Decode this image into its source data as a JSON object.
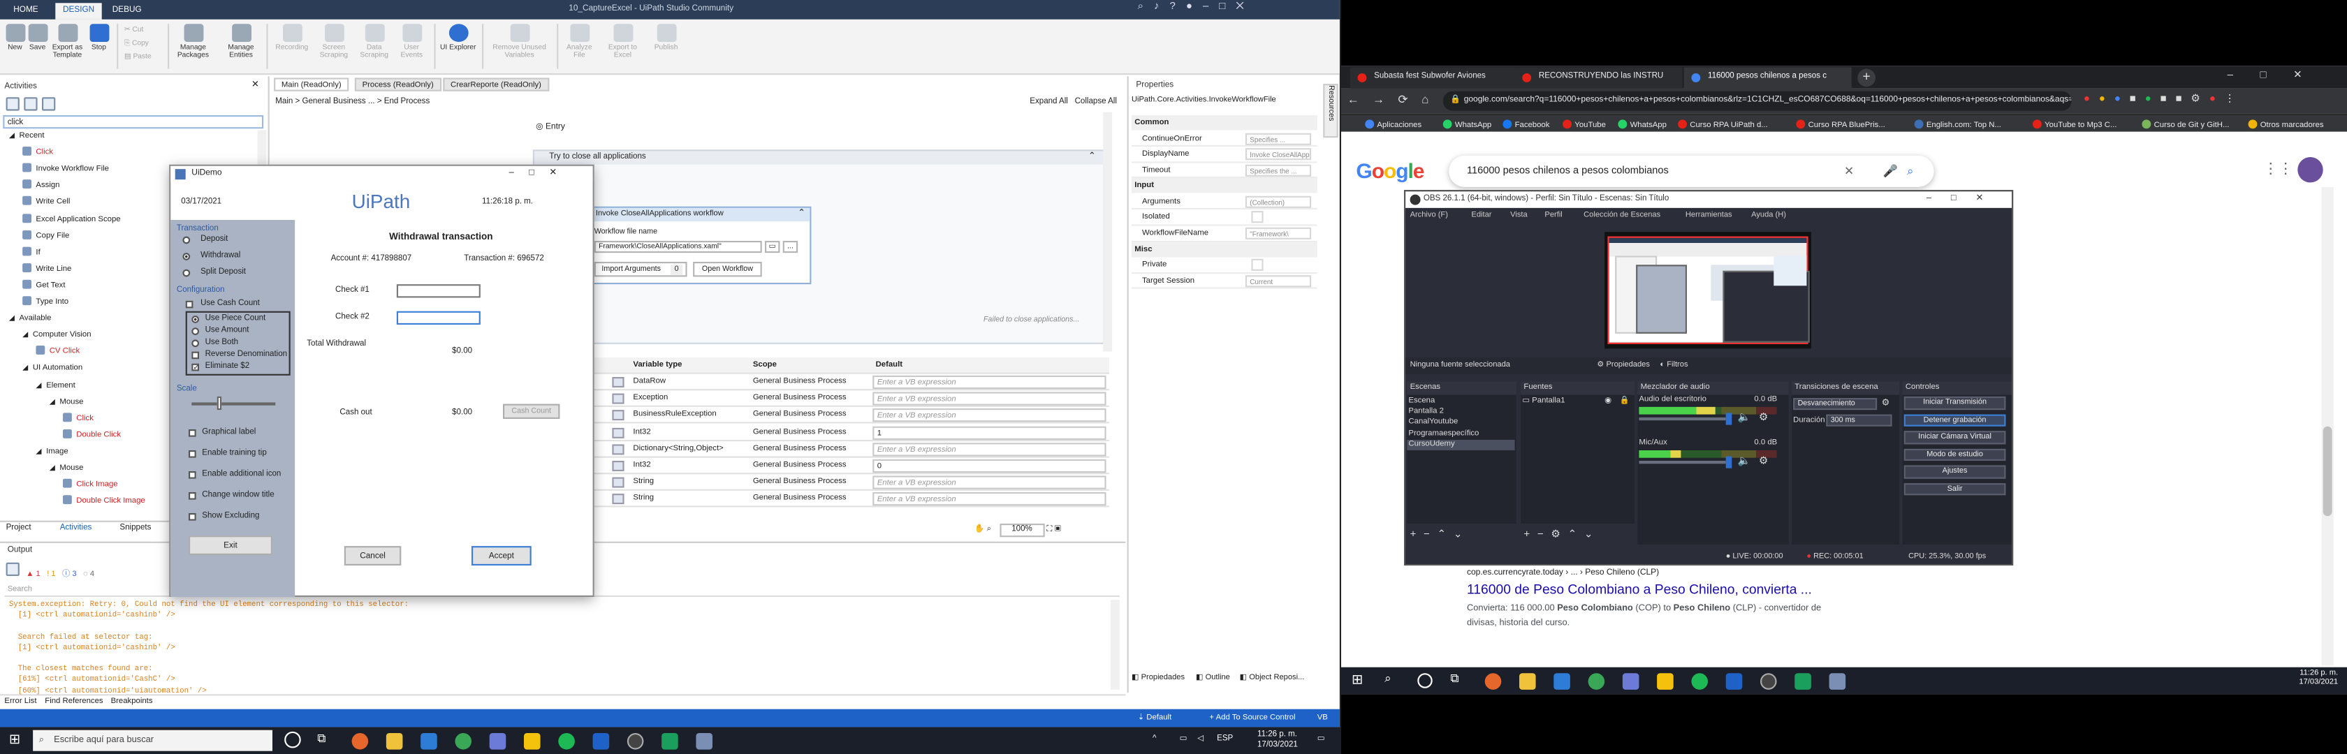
{
  "uipath": {
    "window_title": "10_CaptureExcel - UiPath Studio Community",
    "ribbon_tabs": [
      "HOME",
      "DESIGN",
      "DEBUG"
    ],
    "ribbon_buttons": [
      {
        "label": "New",
        "disabled": false
      },
      {
        "label": "Save",
        "disabled": false
      },
      {
        "label": "Export as Template",
        "disabled": false
      },
      {
        "label": "Stop",
        "disabled": false
      },
      {
        "label": "Cut",
        "disabled": true
      },
      {
        "label": "Copy",
        "disabled": true
      },
      {
        "label": "Paste",
        "disabled": true
      },
      {
        "label": "Manage Packages",
        "disabled": false
      },
      {
        "label": "Manage Entities",
        "disabled": false
      },
      {
        "label": "Recording",
        "disabled": true
      },
      {
        "label": "Screen Scraping",
        "disabled": true
      },
      {
        "label": "Data Scraping",
        "disabled": true
      },
      {
        "label": "User Events",
        "disabled": true
      },
      {
        "label": "UI Explorer",
        "disabled": false
      },
      {
        "label": "Remove Unused Variables",
        "disabled": true
      },
      {
        "label": "Analyze File",
        "disabled": true
      },
      {
        "label": "Export to Excel",
        "disabled": true
      },
      {
        "label": "Publish",
        "disabled": true
      }
    ],
    "activities_panel": {
      "title": "Activities",
      "search_value": "click",
      "rows": [
        {
          "text": "Recent",
          "level": 0
        },
        {
          "text": "Click",
          "level": 1,
          "red": true
        },
        {
          "text": "Invoke Workflow File",
          "level": 1
        },
        {
          "text": "Assign",
          "level": 1
        },
        {
          "text": "Write Cell",
          "level": 1
        },
        {
          "text": "Excel Application Scope",
          "level": 1
        },
        {
          "text": "Copy File",
          "level": 1
        },
        {
          "text": "If",
          "level": 1
        },
        {
          "text": "Write Line",
          "level": 1
        },
        {
          "text": "Get Text",
          "level": 1
        },
        {
          "text": "Type Into",
          "level": 1
        },
        {
          "text": "Available",
          "level": 0
        },
        {
          "text": "Computer Vision",
          "level": 1
        },
        {
          "text": "CV Click",
          "level": 2,
          "red": true
        },
        {
          "text": "UI Automation",
          "level": 1
        },
        {
          "text": "Element",
          "level": 2
        },
        {
          "text": "Mouse",
          "level": 3
        },
        {
          "text": "Click",
          "level": 4,
          "red": true
        },
        {
          "text": "Double Click",
          "level": 4,
          "red": true
        },
        {
          "text": "Image",
          "level": 2
        },
        {
          "text": "Mouse",
          "level": 3
        },
        {
          "text": "Click Image",
          "level": 4,
          "red": true
        },
        {
          "text": "Double Click Image",
          "level": 4,
          "red": true
        }
      ],
      "bottom_tabs": [
        "Project",
        "Activities",
        "Snippets"
      ]
    },
    "doc_tabs": [
      "Main (ReadOnly)",
      "Process (ReadOnly)",
      "CrearReporte (ReadOnly)"
    ],
    "breadcrumb": [
      "Main",
      "General Business ...",
      "End Process"
    ],
    "expand_all": "Expand All",
    "collapse_all": "Collapse All",
    "designer": {
      "entry": "Entry",
      "try_close": "Try to close all applications",
      "invoke_title": "Invoke CloseAllApplications workflow",
      "workflow_file_label": "Workflow file name",
      "workflow_file_value": "Framework\\CloseAllApplications.xaml\"",
      "import_args": "Import Arguments",
      "import_count": "0",
      "open_workflow": "Open Workflow",
      "failed_text": "Failed to close applications..."
    },
    "variables_grid": {
      "headers": [
        "Variable type",
        "Scope",
        "Default"
      ],
      "rows": [
        {
          "type": "DataRow",
          "scope": "General Business Process",
          "default": "Enter a VB expression"
        },
        {
          "type": "Exception",
          "scope": "General Business Process",
          "default": "Enter a VB expression"
        },
        {
          "type": "BusinessRuleException",
          "scope": "General Business Process",
          "default": "Enter a VB expression"
        },
        {
          "type": "Int32",
          "scope": "General Business Process",
          "default": "1"
        },
        {
          "type": "Dictionary<String,Object>",
          "scope": "General Business Process",
          "default": "Enter a VB expression"
        },
        {
          "type": "Int32",
          "scope": "General Business Process",
          "default": "0"
        },
        {
          "type": "String",
          "scope": "General Business Process",
          "default": "Enter a VB expression"
        },
        {
          "type": "String",
          "scope": "General Business Process",
          "default": "Enter a VB expression"
        }
      ],
      "zoom": "100%"
    },
    "properties": {
      "title": "Properties",
      "type_name": "UiPath.Core.Activities.InvokeWorkflowFile",
      "categories": [
        {
          "name": "Common",
          "rows": [
            {
              "label": "ContinueOnError",
              "value": "Specifies ..."
            },
            {
              "label": "DisplayName",
              "value": "Invoke CloseAllApp"
            },
            {
              "label": "Timeout",
              "value": "Specifies the ..."
            }
          ]
        },
        {
          "name": "Input",
          "rows": [
            {
              "label": "Arguments",
              "value": "(Collection)"
            },
            {
              "label": "Isolated",
              "value": ""
            },
            {
              "label": "WorkflowFileName",
              "value": "\"Framework\\"
            }
          ]
        },
        {
          "name": "Misc",
          "rows": [
            {
              "label": "Private",
              "value": ""
            },
            {
              "label": "Target Session",
              "value": "Current"
            }
          ]
        }
      ],
      "bottom_tabs": [
        "Propiedades",
        "Outline",
        "Object Reposi..."
      ],
      "side_tab": "Resources"
    },
    "output": {
      "title": "Output",
      "filter_counts": [
        "1",
        "1",
        "3",
        "4"
      ],
      "search_placeholder": "Search",
      "lines": [
        {
          "text": "System.exception: Retry: 0, Could not find the UI element corresponding to this selector:",
          "color": "#d9821f"
        },
        {
          "text": "[1] <ctrl automationid='cashinb' />",
          "color": "#d9821f"
        },
        {
          "text": "",
          "color": "#d9821f"
        },
        {
          "text": "Search failed at selector tag:",
          "color": "#d9821f"
        },
        {
          "text": "[1] <ctrl automationid='cashinb' />",
          "color": "#d9821f"
        },
        {
          "text": "",
          "color": "#d9821f"
        },
        {
          "text": "The closest matches found are:",
          "color": "#d9821f"
        },
        {
          "text": "[61%] <ctrl automationid='CashC' />",
          "color": "#d9821f"
        },
        {
          "text": "[60%] <ctrl automationid='uiautomation' />",
          "color": "#d9821f"
        }
      ],
      "bottom_tabs": [
        "Error List",
        "Find References",
        "Breakpoints"
      ]
    },
    "status_bar": {
      "config": "Default",
      "source_control": "Add To Source Control",
      "lang": "VB"
    }
  },
  "uidemo": {
    "title": "UiDemo",
    "date": "03/17/2021",
    "brand": "UiPath",
    "time": "11:26:18 p. m.",
    "transaction_label": "Transaction",
    "transaction_options": [
      "Deposit",
      "Withdrawal",
      "Split Deposit"
    ],
    "selected_transaction": "Withdrawal",
    "configuration_label": "Configuration",
    "use_cash_count": "Use Cash Count",
    "config_options": [
      "Use Piece Count",
      "Use Amount",
      "Use Both",
      "Reverse Denomination",
      "Eliminate $2"
    ],
    "scale_label": "Scale",
    "scale_value": 0.33,
    "checkboxes": [
      "Graphical label",
      "Enable training tip",
      "Enable additional icon",
      "Change window title",
      "Show Excluding"
    ],
    "exit": "Exit",
    "heading": "Withdrawal transaction",
    "account": "Account #: 417898807",
    "transaction_no": "Transaction #: 696572",
    "check1": "Check #1",
    "check2": "Check #2",
    "total_withdrawal": "Total Withdrawal",
    "total_value": "$0.00",
    "cash_out": "Cash out",
    "cash_out_value": "$0.00",
    "cash_count_btn": "Cash Count",
    "cancel": "Cancel",
    "accept": "Accept"
  },
  "taskbar_left": {
    "search_placeholder": "Escribe aquí para buscar",
    "time": "11:26 p. m.",
    "date": "17/03/2021",
    "lang": "ESP"
  },
  "taskbar_right": {
    "time": "11:26 p. m.",
    "date": "17/03/2021"
  },
  "chrome": {
    "tabs": [
      {
        "title": "Subasta fest Subwofer Aviones",
        "fav": "#e62117",
        "active": false
      },
      {
        "title": "RECONSTRUYENDO las INSTRU",
        "fav": "#e62117",
        "active": false
      },
      {
        "title": "116000 pesos chilenos a pesos c",
        "fav": "#4285f4",
        "active": true
      }
    ],
    "url": "google.com/search?q=116000+pesos+chilenos+a+pesos+colombianos&rlz=1C1CHZL_esCO687CO688&oq=116000+pesos+chilenos+a+pesos+colombianos&aqs=chrome..69i57.8080j0j7&sourceid=chrome&ie=UTF-8",
    "bookmarks": [
      {
        "label": "Aplicaciones",
        "color": "#4285f4"
      },
      {
        "label": "WhatsApp",
        "color": "#25d366"
      },
      {
        "label": "Facebook",
        "color": "#1877f2"
      },
      {
        "label": "YouTube",
        "color": "#e62117"
      },
      {
        "label": "WhatsApp",
        "color": "#25d366"
      },
      {
        "label": "Curso RPA UiPath d...",
        "color": "#e62117"
      },
      {
        "label": "Curso RPA BluePris...",
        "color": "#e62117"
      },
      {
        "label": "English.com: Top N...",
        "color": "#3d6fb6"
      },
      {
        "label": "YouTube to Mp3 C...",
        "color": "#e62117"
      },
      {
        "label": "Curso de Git y GitH...",
        "color": "#7ab55c"
      },
      {
        "label": "Otros marcadores",
        "color": "#f0b400"
      }
    ],
    "search_query": "116000 pesos chilenos a pesos colombianos",
    "google_letters": [
      "G",
      "o",
      "o",
      "g",
      "l",
      "e"
    ],
    "result": {
      "cite": "cop.es.currencyrate.today › ... › Peso Chileno (CLP)",
      "title": "116000 de Peso Colombiano a Peso Chileno, convierta ...",
      "snippet_a": "Convierta:",
      "snippet_b": "116 000.00",
      "snippet_c": "Peso Colombiano",
      "snippet_d": "(COP) to",
      "snippet_e": "Peso Chileno",
      "snippet_f": "(CLP) - convertidor de",
      "snippet_2": "divisas, historia del curso."
    }
  },
  "obs": {
    "title": "OBS 26.1.1 (64-bit, windows) - Perfil: Sin Título - Escenas: Sin Título",
    "menu": [
      "Archivo (F)",
      "Editar",
      "Vista",
      "Perfil",
      "Colección de Escenas",
      "Herramientas",
      "Ayuda (H)"
    ],
    "no_source": "Ninguna fuente seleccionada",
    "props": "Propiedades",
    "filters": "Filtros",
    "panels": {
      "scenes": "Escenas",
      "sources": "Fuentes",
      "mixer": "Mezclador de audio",
      "transitions": "Transiciones de escena",
      "controls": "Controles"
    },
    "scenes": [
      "Escena",
      "Pantalla 2",
      "CanalYoutube",
      "Programaespecífico",
      "CursoUdemy"
    ],
    "selected_scene": "CursoUdemy",
    "sources": [
      "Pantalla1"
    ],
    "mixer": [
      {
        "name": "Audio del escritorio",
        "db": "0.0 dB",
        "level": 0.55
      },
      {
        "name": "Mic/Aux",
        "db": "0.0 dB",
        "level": 0.3
      }
    ],
    "transition": "Desvanecimiento",
    "duration_label": "Duración",
    "duration": "300 ms",
    "controls": [
      "Iniciar Transmisión",
      "Detener grabación",
      "Iniciar Cámara Virtual",
      "Modo de estudio",
      "Ajustes",
      "Salir"
    ],
    "status": {
      "live": "LIVE: 00:00:00",
      "rec": "REC: 00:05:01",
      "cpu": "CPU: 25.3%, 30.00 fps"
    }
  }
}
